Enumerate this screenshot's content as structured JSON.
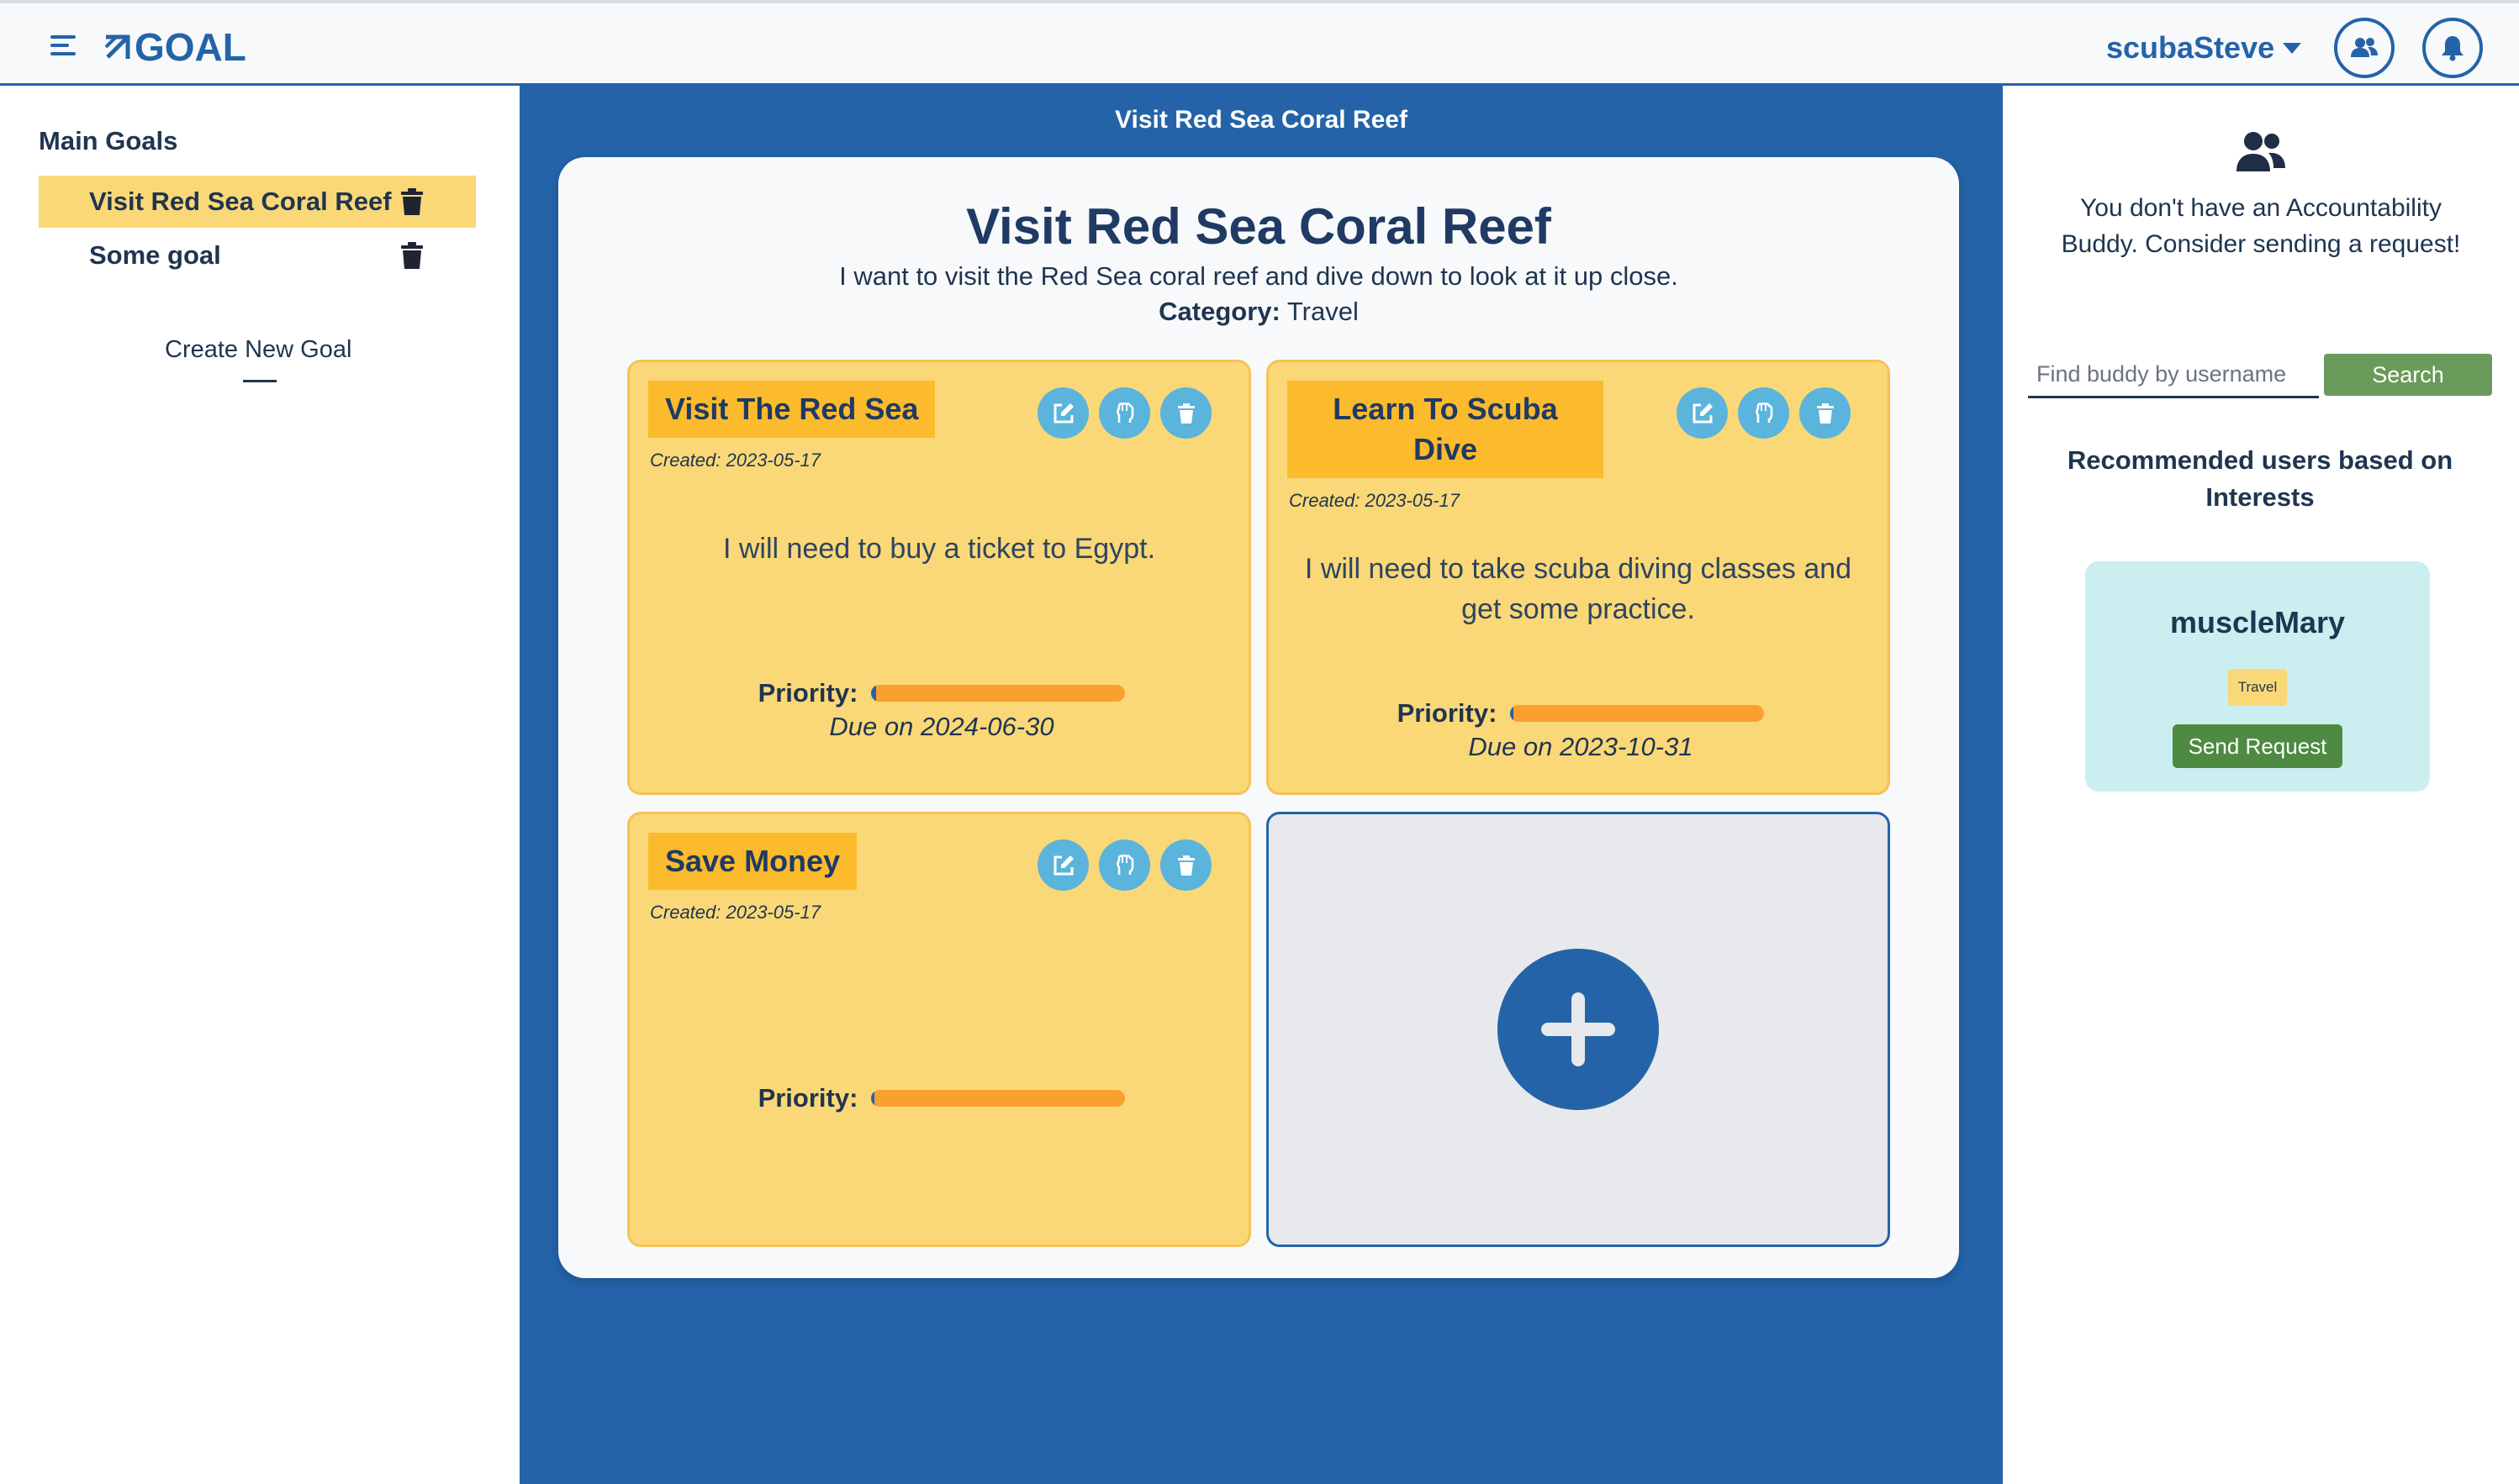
{
  "header": {
    "logo_text": "GOAL",
    "username": "scubaSteve"
  },
  "icons": {
    "menu": "menu-icon",
    "logo": "arrow-logo-icon",
    "buddies": "users-icon",
    "notifications": "bell-icon",
    "trash": "trash-icon",
    "edit": "edit-icon",
    "fist": "fist-icon",
    "add": "plus-icon"
  },
  "sidebar": {
    "title": "Main Goals",
    "goals": [
      {
        "label": "Visit Red Sea Coral Reef",
        "active": true
      },
      {
        "label": "Some goal",
        "active": false
      }
    ],
    "create_label": "Create New Goal"
  },
  "main": {
    "title": "Visit Red Sea Coral Reef",
    "heading": "Visit Red Sea Coral Reef",
    "description": "I want to visit the Red Sea coral reef and dive down to look at it up close.",
    "category_label": "Category:",
    "category_value": "Travel",
    "subgoals": [
      {
        "title": "Visit The Red Sea",
        "created": "Created: 2023-05-17",
        "note": "I will need to buy a ticket to Egypt.",
        "priority_label": "Priority:",
        "priority_fraction": 0.02,
        "due": "Due on 2024-06-30"
      },
      {
        "title": "Learn To Scuba Dive",
        "created": "Created: 2023-05-17",
        "note": "I will need to take scuba diving classes and get some practice.",
        "priority_label": "Priority:",
        "priority_fraction": 0.01,
        "due": "Due on 2023-10-31"
      },
      {
        "title": "Save Money",
        "created": "Created: 2023-05-17",
        "note": "",
        "priority_label": "Priority:",
        "priority_fraction": 0.01,
        "due": ""
      }
    ]
  },
  "rightbar": {
    "no_buddy_message": "You don't have an Accountability Buddy. Consider sending a request!",
    "search_placeholder": "Find buddy by username",
    "search_button": "Search",
    "recommend_title": "Recommended users based on Interests",
    "recommended": [
      {
        "username": "muscleMary",
        "tag": "Travel",
        "button": "Send Request"
      }
    ]
  },
  "colors": {
    "primary_blue": "#2463a8",
    "card_yellow": "#fad877",
    "title_yellow": "#fcba2d",
    "priority_orange": "#fb9f31",
    "icon_blue": "#5ab4dc",
    "search_green": "#6a9b5a",
    "send_green": "#4e8a42",
    "user_card_cyan": "#cbeff0"
  }
}
